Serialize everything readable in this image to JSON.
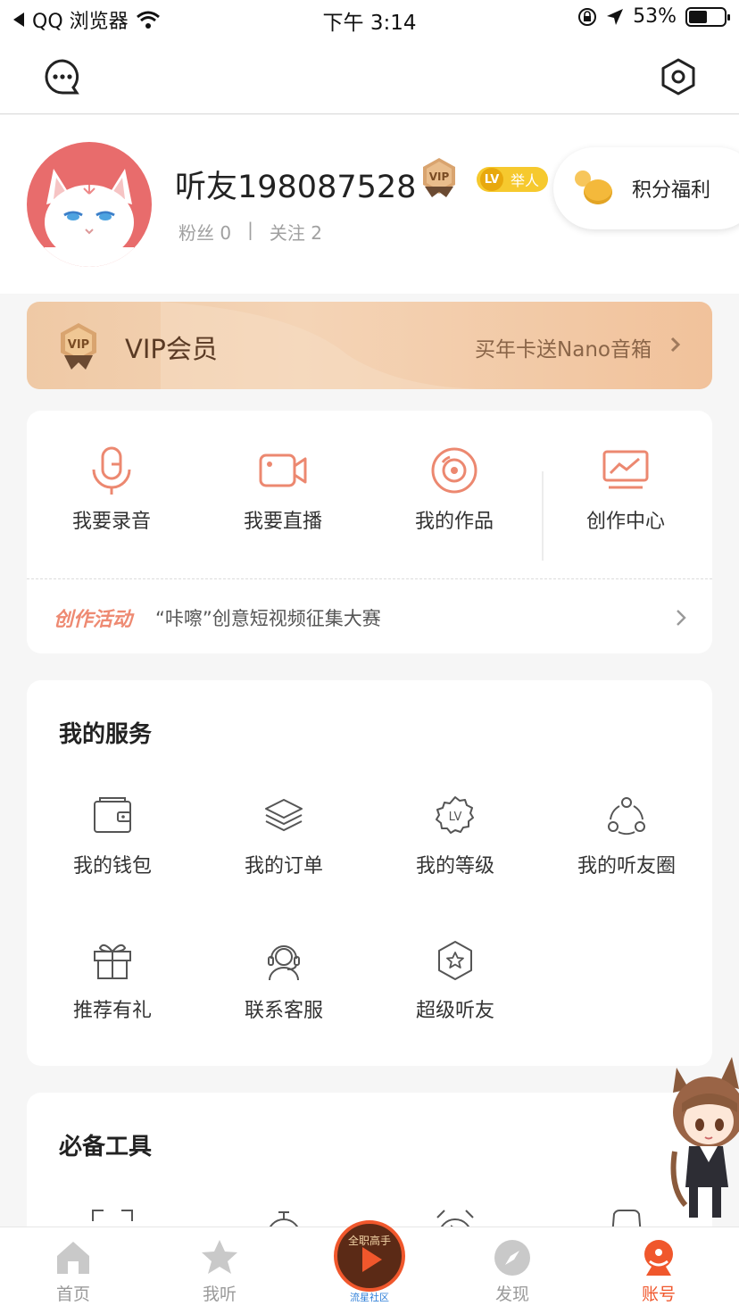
{
  "status_bar": {
    "back_app": "QQ 浏览器",
    "time": "下午 3:14",
    "battery": "53%"
  },
  "profile": {
    "username": "听友198087528",
    "vip_badge_text": "VIP",
    "level_text": "LV",
    "level_title": "举人",
    "fans_label": "粉丝",
    "fans_count": "0",
    "following_label": "关注",
    "following_count": "2",
    "points_label": "积分福利"
  },
  "vip_banner": {
    "icon_text": "VIP",
    "title": "VIP会员",
    "promo": "买年卡送Nano音箱"
  },
  "create": {
    "items": [
      {
        "label": "我要录音",
        "icon": "microphone-icon"
      },
      {
        "label": "我要直播",
        "icon": "video-camera-icon"
      },
      {
        "label": "我的作品",
        "icon": "disc-icon"
      },
      {
        "label": "创作中心",
        "icon": "monitor-chart-icon"
      }
    ],
    "activity_tag": "创作活动",
    "activity_text": "“咔嚓”创意短视频征集大赛"
  },
  "services": {
    "title": "我的服务",
    "items": [
      {
        "label": "我的钱包",
        "icon": "wallet-icon"
      },
      {
        "label": "我的订单",
        "icon": "layers-icon"
      },
      {
        "label": "我的等级",
        "icon": "level-badge-icon"
      },
      {
        "label": "我的听友圈",
        "icon": "circle-nodes-icon"
      },
      {
        "label": "推荐有礼",
        "icon": "gift-icon"
      },
      {
        "label": "联系客服",
        "icon": "headset-icon"
      },
      {
        "label": "超级听友",
        "icon": "star-shield-icon"
      }
    ]
  },
  "tools": {
    "title": "必备工具"
  },
  "tab_bar": {
    "tabs": [
      {
        "label": "首页",
        "icon": "home-icon",
        "active": false
      },
      {
        "label": "我听",
        "icon": "star-icon",
        "active": false
      },
      {
        "label": "发现",
        "icon": "compass-icon",
        "active": false
      },
      {
        "label": "账号",
        "icon": "account-icon",
        "active": true
      }
    ],
    "center_cover_text": "全职高手",
    "center_label": "流星社区"
  },
  "colors": {
    "accent": "#f0572c",
    "icon_orange": "#ec8870",
    "vip_gold": "#d9a46f"
  }
}
